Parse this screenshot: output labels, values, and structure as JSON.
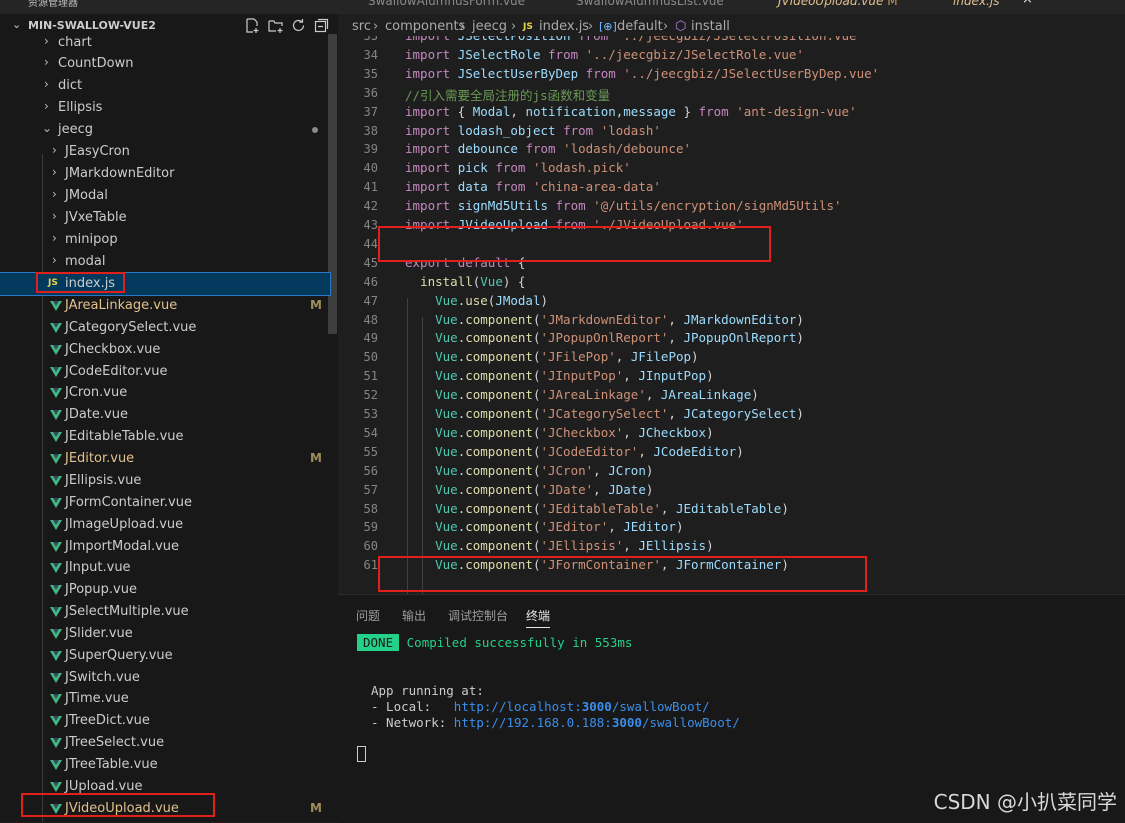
{
  "top_tabs": [
    {
      "label": "SwallowAlumnusForm.vue"
    },
    {
      "label": "SwallowAlumnusList.vue"
    },
    {
      "label": "JVideoUpload.vue",
      "badge": "M"
    },
    {
      "label": "index.js"
    }
  ],
  "top_left_text": "资源管理器",
  "explorer": {
    "title": "MIN-SWALLOW-VUE2"
  },
  "tree": {
    "folders": [
      "chart",
      "CountDown",
      "dict",
      "Ellipsis",
      "jeecg"
    ],
    "subfolders": [
      "JEasyCron",
      "JMarkdownEditor",
      "JModal",
      "JVxeTable",
      "minipop",
      "modal"
    ],
    "selected_file": "index.js",
    "files": [
      {
        "name": "JAreaLinkage.vue",
        "badge": "M"
      },
      {
        "name": "JCategorySelect.vue"
      },
      {
        "name": "JCheckbox.vue"
      },
      {
        "name": "JCodeEditor.vue"
      },
      {
        "name": "JCron.vue"
      },
      {
        "name": "JDate.vue"
      },
      {
        "name": "JEditableTable.vue"
      },
      {
        "name": "JEditor.vue",
        "badge": "M"
      },
      {
        "name": "JEllipsis.vue"
      },
      {
        "name": "JFormContainer.vue"
      },
      {
        "name": "JImageUpload.vue"
      },
      {
        "name": "JImportModal.vue"
      },
      {
        "name": "JInput.vue"
      },
      {
        "name": "JPopup.vue"
      },
      {
        "name": "JSelectMultiple.vue"
      },
      {
        "name": "JSlider.vue"
      },
      {
        "name": "JSuperQuery.vue"
      },
      {
        "name": "JSwitch.vue"
      },
      {
        "name": "JTime.vue"
      },
      {
        "name": "JTreeDict.vue"
      },
      {
        "name": "JTreeSelect.vue"
      },
      {
        "name": "JTreeTable.vue"
      },
      {
        "name": "JUpload.vue"
      },
      {
        "name": "JVideoUpload.vue",
        "badge": "M"
      }
    ]
  },
  "breadcrumb": {
    "parts": [
      "src",
      "components",
      "jeecg",
      "index.js",
      "default",
      "install"
    ]
  },
  "code": {
    "first_line_no": 33,
    "lines": [
      "import JSelectPosition from '../jeecgbiz/JSelectPosition.vue'",
      "import JSelectRole from '../jeecgbiz/JSelectRole.vue'",
      "import JSelectUserByDep from '../jeecgbiz/JSelectUserByDep.vue'",
      "//引入需要全局注册的js函数和变量",
      "import { Modal, notification,message } from 'ant-design-vue'",
      "import lodash_object from 'lodash'",
      "import debounce from 'lodash/debounce'",
      "import pick from 'lodash.pick'",
      "import data from 'china-area-data'",
      "import signMd5Utils from '@/utils/encryption/signMd5Utils'",
      "import JVideoUpload from './JVideoUpload.vue'",
      "",
      "export default {",
      "  install(Vue) {",
      "    Vue.use(JModal)",
      "    Vue.component('JMarkdownEditor', JMarkdownEditor)",
      "    Vue.component('JPopupOnlReport', JPopupOnlReport)",
      "    Vue.component('JFilePop', JFilePop)",
      "    Vue.component('JInputPop', JInputPop)",
      "    Vue.component('JAreaLinkage', JAreaLinkage)",
      "    Vue.component('JCategorySelect', JCategorySelect)",
      "    Vue.component('JCheckbox', JCheckbox)",
      "    Vue.component('JCodeEditor', JCodeEditor)",
      "    Vue.component('JCron', JCron)",
      "    Vue.component('JDate', JDate)",
      "    Vue.component('JEditableTable', JEditableTable)",
      "    Vue.component('JEditor', JEditor)",
      "    Vue.component('JEllipsis', JEllipsis)",
      "    Vue.component('JFormContainer', JFormContainer)"
    ]
  },
  "panel": {
    "tabs": [
      "问题",
      "输出",
      "调试控制台",
      "终端"
    ],
    "active_tab": "终端",
    "done_badge": "DONE",
    "compiled_text": "Compiled successfully in 553ms",
    "running_text": "App running at:",
    "local_label": "- Local:   ",
    "local_url_prefix": "http://localhost:",
    "local_port": "3000",
    "local_url_suffix": "/swallowBoot/",
    "network_label": "- Network: ",
    "network_url_prefix": "http://192.168.0.188:",
    "network_port": "3000",
    "network_url_suffix": "/swallowBoot/"
  },
  "watermark": "CSDN @小扒菜同学",
  "colors": {
    "highlight_box": "#e0201b",
    "vue_icon": "#41b883",
    "js_icon": "#e8d44d",
    "modified": "#e2c08d"
  }
}
